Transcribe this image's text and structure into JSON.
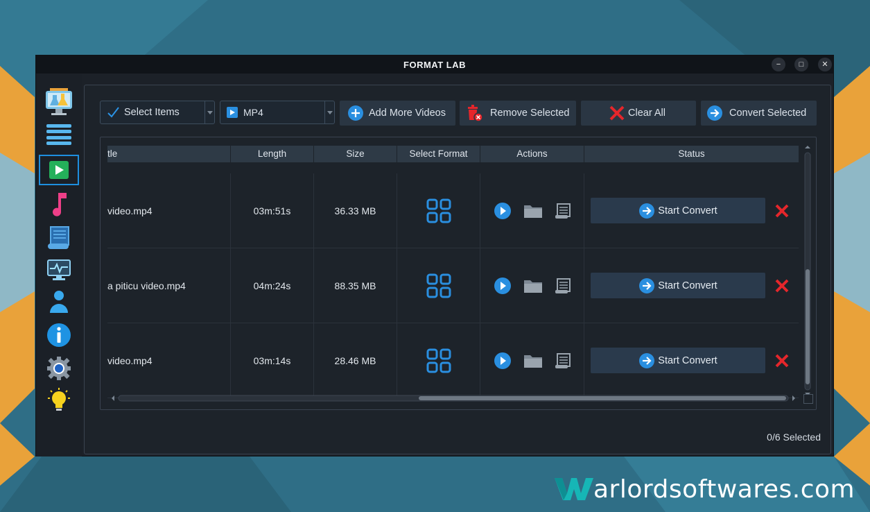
{
  "window": {
    "title": "FORMAT LAB",
    "minimize": "−",
    "maximize": "□",
    "close": "✕"
  },
  "sidebar": {
    "items": [
      {
        "name": "lab-icon",
        "active": false
      },
      {
        "name": "list-icon",
        "active": false
      },
      {
        "name": "video-play-icon",
        "active": true
      },
      {
        "name": "music-note-icon",
        "active": false
      },
      {
        "name": "document-scroll-icon",
        "active": false
      },
      {
        "name": "monitor-pulse-icon",
        "active": false
      },
      {
        "name": "user-icon",
        "active": false
      },
      {
        "name": "info-icon",
        "active": false
      },
      {
        "name": "settings-gear-icon",
        "active": false
      },
      {
        "name": "lightbulb-icon",
        "active": false
      }
    ]
  },
  "toolbar": {
    "select_items": "Select Items",
    "format_value": "MP4",
    "add_more": "Add More Videos",
    "remove_selected": "Remove Selected",
    "clear_all": "Clear All",
    "convert_selected": "Convert Selected"
  },
  "table": {
    "columns": [
      "tle",
      "Length",
      "Size",
      "Select Format",
      "Actions",
      "Status"
    ],
    "rows": [
      {
        "title": "video.mp4",
        "length": "03m:51s",
        "size": "36.33 MB",
        "status": "Start Convert"
      },
      {
        "title": "a piticu video.mp4",
        "length": "04m:24s",
        "size": "88.35 MB",
        "status": "Start Convert"
      },
      {
        "title": "video.mp4",
        "length": "03m:14s",
        "size": "28.46 MB",
        "status": "Start Convert"
      }
    ]
  },
  "footer": {
    "selected": "0/6 Selected"
  },
  "watermark": {
    "text": "arlordsoftwares.com"
  },
  "colors": {
    "accent": "#1e8fe0",
    "danger": "#e5262b",
    "background": "#2f6e86",
    "window": "#1c2128"
  }
}
